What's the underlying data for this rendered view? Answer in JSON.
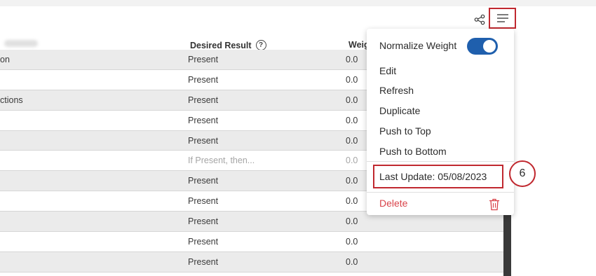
{
  "header": {
    "desired_result": "Desired Result",
    "weight": "Weig"
  },
  "rows": [
    {
      "name": "on",
      "result": "Present",
      "weight": "0.0",
      "shade": true
    },
    {
      "name": "",
      "result": "Present",
      "weight": "0.0",
      "shade": false
    },
    {
      "name": "ctions",
      "result": "Present",
      "weight": "0.0",
      "shade": true
    },
    {
      "name": "",
      "result": "Present",
      "weight": "0.0",
      "shade": false
    },
    {
      "name": "",
      "result": "Present",
      "weight": "0.0",
      "shade": true
    },
    {
      "name": "",
      "result": "If Present, then...",
      "weight": "0.0",
      "shade": false,
      "muted": true
    },
    {
      "name": "",
      "result": "Present",
      "weight": "0.0",
      "shade": true
    },
    {
      "name": "",
      "result": "Present",
      "weight": "0.0",
      "shade": false
    },
    {
      "name": "",
      "result": "Present",
      "weight": "0.0",
      "shade": true
    },
    {
      "name": "",
      "result": "Present",
      "weight": "0.0",
      "shade": false
    },
    {
      "name": "",
      "result": "Present",
      "weight": "0.0",
      "shade": true
    }
  ],
  "menu": {
    "normalize_weight": "Normalize Weight",
    "normalize_on": true,
    "edit": "Edit",
    "refresh": "Refresh",
    "duplicate": "Duplicate",
    "push_top": "Push to Top",
    "push_bottom": "Push to Bottom",
    "last_update": "Last Update: 05/08/2023",
    "delete": "Delete"
  },
  "icons": {
    "share": "share-icon",
    "menu": "hamburger-menu-icon",
    "help": "help-circle-icon",
    "trash": "trash-icon"
  },
  "step_badge": "6",
  "colors": {
    "accent_red": "#c0282f",
    "toggle_blue": "#1f5fad",
    "delete_red": "#d9434a"
  }
}
